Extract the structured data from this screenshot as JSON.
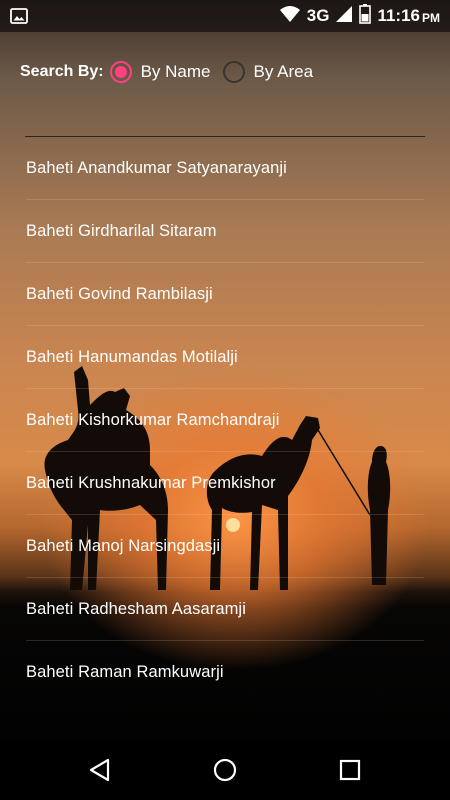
{
  "status_bar": {
    "network": "3G",
    "time": "11:16",
    "ampm": "PM",
    "icons": [
      "image-icon",
      "wifi-icon",
      "signal-icon",
      "battery-icon"
    ]
  },
  "search": {
    "label": "Search By:",
    "options": [
      {
        "label": "By Name",
        "selected": true
      },
      {
        "label": "By Area",
        "selected": false
      }
    ]
  },
  "names": [
    "Baheti Anandkumar Satyanarayanji",
    "Baheti Girdharilal Sitaram",
    "Baheti Govind Rambilasji",
    "Baheti Hanumandas Motilalji",
    "Baheti Kishorkumar Ramchandraji",
    "Baheti Krushnakumar Premkishor",
    "Baheti Manoj Narsingdasji",
    "Baheti Radhesham Aasaramji",
    "Baheti Raman Ramkuwarji"
  ],
  "nav": {
    "icons": [
      "back-icon",
      "home-icon",
      "recents-icon"
    ]
  },
  "colors": {
    "accent": "#ff4081"
  }
}
